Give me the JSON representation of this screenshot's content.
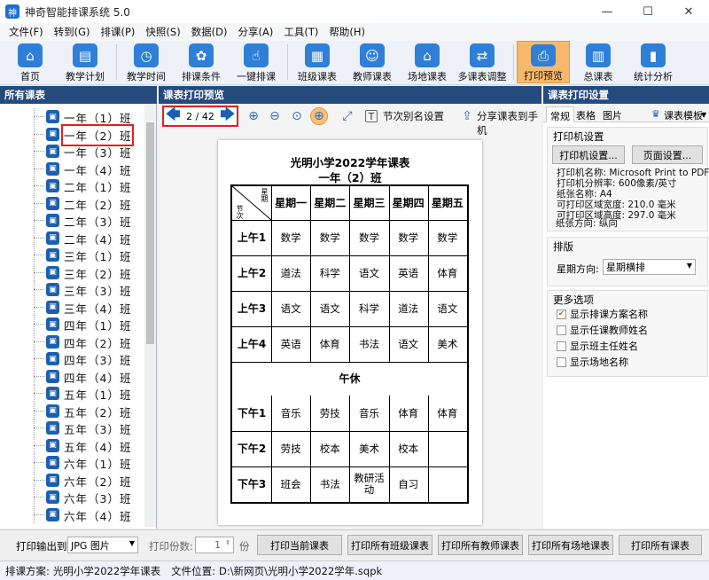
{
  "window": {
    "title": "神奇智能排课系统 5.0",
    "min": "—",
    "max": "☐",
    "close": "✕"
  },
  "menu": [
    "文件(F)",
    "转到(G)",
    "排课(P)",
    "快照(S)",
    "数据(D)",
    "分享(A)",
    "工具(T)",
    "帮助(H)"
  ],
  "toolbar": [
    {
      "label": "首页",
      "icon": "home-icon",
      "glyph": "⌂"
    },
    {
      "label": "教学计划",
      "icon": "plan-icon",
      "glyph": "▤"
    },
    {
      "label": "教学时间",
      "icon": "clock-icon",
      "glyph": "◷"
    },
    {
      "label": "排课条件",
      "icon": "conditions-icon",
      "glyph": "✿"
    },
    {
      "label": "一键排课",
      "icon": "one-click-icon",
      "glyph": "☝"
    },
    {
      "label": "班级课表",
      "icon": "class-schedule-icon",
      "glyph": "▦"
    },
    {
      "label": "教师课表",
      "icon": "teacher-schedule-icon",
      "glyph": "☺"
    },
    {
      "label": "场地课表",
      "icon": "venue-schedule-icon",
      "glyph": "⌂"
    },
    {
      "label": "多课表调整",
      "icon": "multi-adjust-icon",
      "glyph": "⇄"
    },
    {
      "label": "打印预览",
      "icon": "print-icon",
      "glyph": "⎙"
    },
    {
      "label": "总课表",
      "icon": "master-schedule-icon",
      "glyph": "▥"
    },
    {
      "label": "统计分析",
      "icon": "stats-icon",
      "glyph": "▮"
    }
  ],
  "left_panel": {
    "title": "所有课表",
    "classes": [
      "一年（1）班",
      "一年（2）班",
      "一年（3）班",
      "一年（4）班",
      "二年（1）班",
      "二年（2）班",
      "二年（3）班",
      "二年（4）班",
      "三年（1）班",
      "三年（2）班",
      "三年（3）班",
      "三年（4）班",
      "四年（1）班",
      "四年（2）班",
      "四年（3）班",
      "四年（4）班",
      "五年（1）班",
      "五年（2）班",
      "五年（3）班",
      "五年（4）班",
      "六年（1）班",
      "六年（2）班",
      "六年（3）班",
      "六年（4）班"
    ],
    "selected_index": 1
  },
  "center_panel": {
    "title": "课表打印预览",
    "page_indicator": "2 / 42",
    "alias_label": "节次别名设置",
    "share_label": "分享课表到手机",
    "doc": {
      "title": "光明小学2022学年课表",
      "subtitle": "一年（2）班",
      "corner_top": "星期",
      "corner_bottom": "节次",
      "days": [
        "星期一",
        "星期二",
        "星期三",
        "星期四",
        "星期五"
      ],
      "rows": [
        {
          "label": "上午1",
          "cells": [
            "数学",
            "数学",
            "数学",
            "数学",
            "数学"
          ]
        },
        {
          "label": "上午2",
          "cells": [
            "道法",
            "科学",
            "语文",
            "英语",
            "体育"
          ]
        },
        {
          "label": "上午3",
          "cells": [
            "语文",
            "语文",
            "科学",
            "道法",
            "语文"
          ]
        },
        {
          "label": "上午4",
          "cells": [
            "英语",
            "体育",
            "书法",
            "语文",
            "美术"
          ]
        },
        {
          "label": "下午1",
          "cells": [
            "音乐",
            "劳技",
            "音乐",
            "体育",
            "体育"
          ]
        },
        {
          "label": "下午2",
          "cells": [
            "劳技",
            "校本",
            "美术",
            "校本",
            ""
          ]
        },
        {
          "label": "下午3",
          "cells": [
            "班会",
            "书法",
            "教研活动",
            "自习",
            ""
          ]
        }
      ],
      "lunch": "午休"
    }
  },
  "right_panel": {
    "title": "课表打印设置",
    "tabs": [
      "常规",
      "表格",
      "图片"
    ],
    "template_label": "课表模板",
    "printer_group": "打印机设置",
    "printer_settings_btn": "打印机设置...",
    "page_settings_btn": "页面设置...",
    "printer_info": [
      "打印机名称: Microsoft Print to PDF",
      "打印机分辨率: 600像素/英寸",
      "纸张名称: A4",
      "可打印区域宽度: 210.0 毫米",
      "可打印区域高度: 297.0 毫米",
      "纸张方向: 纵向"
    ],
    "layout_group": "排版",
    "week_dir_label": "星期方向:",
    "week_dir_value": "星期横排",
    "more_group": "更多选项",
    "options": [
      {
        "label": "显示排课方案名称",
        "checked": true
      },
      {
        "label": "显示任课教师姓名",
        "checked": false
      },
      {
        "label": "显示班主任姓名",
        "checked": false
      },
      {
        "label": "显示场地名称",
        "checked": false
      }
    ]
  },
  "bottom": {
    "output_label": "打印输出到:",
    "output_value": "JPG 图片",
    "copies_label": "打印份数:",
    "copies_value": "1",
    "copies_unit": "份",
    "buttons": [
      "打印当前课表",
      "打印所有班级课表",
      "打印所有教师课表",
      "打印所有场地课表",
      "打印所有课表"
    ]
  },
  "status": {
    "scheme_label": "排课方案:",
    "scheme_value": "光明小学2022学年课表",
    "file_label": "文件位置:",
    "file_value": "D:\\新网页\\光明小学2022学年.sqpk"
  }
}
